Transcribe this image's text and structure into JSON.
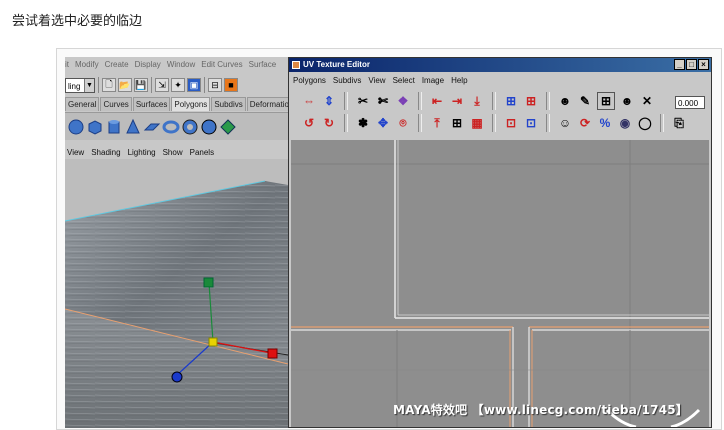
{
  "caption": "尝试着选中必要的临边",
  "maya": {
    "menu": [
      "it",
      "Modify",
      "Create",
      "Display",
      "Window",
      "Edit Curves",
      "Surface"
    ],
    "mode_combo": "ling",
    "shelf_tabs": [
      "General",
      "Curves",
      "Surfaces",
      "Polygons",
      "Subdivs",
      "Deformation"
    ],
    "active_tab": "Polygons",
    "panel_menu": [
      "View",
      "Shading",
      "Lighting",
      "Show",
      "Panels"
    ]
  },
  "uv_editor": {
    "title": "UV Texture Editor",
    "menu": [
      "Polygons",
      "Subdivs",
      "View",
      "Select",
      "Image",
      "Help"
    ],
    "value_field": "0.000",
    "window_buttons": [
      "_",
      "□",
      "×"
    ]
  },
  "watermark": "MAYA特效吧 【www.linecg.com/tieba/1745】",
  "colors": {
    "titlebar": "#0a246a",
    "manip_green": "#1a8a3a",
    "manip_red": "#d11",
    "manip_blue": "#1a3acc",
    "manip_yellow": "#e8d200",
    "edge_highlight": "#e8a070"
  }
}
